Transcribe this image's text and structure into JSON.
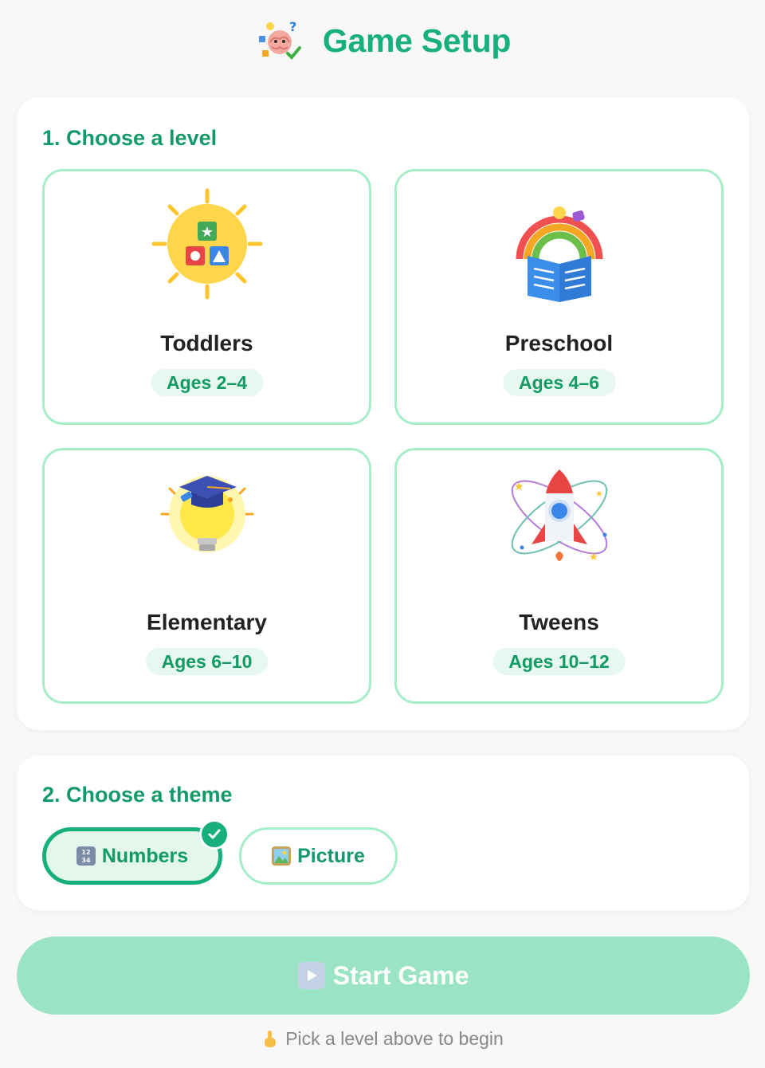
{
  "header": {
    "title": "Game Setup",
    "logo_icon": "brain-puzzle-icon"
  },
  "level_section": {
    "title": "1. Choose a level",
    "levels": [
      {
        "name": "Toddlers",
        "ages": "Ages 2–4",
        "icon": "sun-blocks-icon"
      },
      {
        "name": "Preschool",
        "ages": "Ages 4–6",
        "icon": "rainbow-book-icon"
      },
      {
        "name": "Elementary",
        "ages": "Ages 6–10",
        "icon": "graduation-bulb-icon"
      },
      {
        "name": "Tweens",
        "ages": "Ages 10–12",
        "icon": "rocket-orbit-icon"
      }
    ]
  },
  "theme_section": {
    "title": "2. Choose a theme",
    "options": [
      {
        "label": "Numbers",
        "icon": "numbers-keycap-icon",
        "selected": true
      },
      {
        "label": "Picture",
        "icon": "framed-picture-icon",
        "selected": false
      }
    ]
  },
  "start_button": {
    "label": "Start Game",
    "icon": "play-button-icon",
    "enabled": false
  },
  "hint": {
    "text": "Pick a level above to begin",
    "icon": "pointing-finger-icon"
  },
  "colors": {
    "accent": "#17b07a",
    "accent_dark": "#149a68",
    "tile_border": "#a6edc9",
    "badge_bg": "#e6f8ef",
    "start_disabled": "#9be3c5"
  }
}
